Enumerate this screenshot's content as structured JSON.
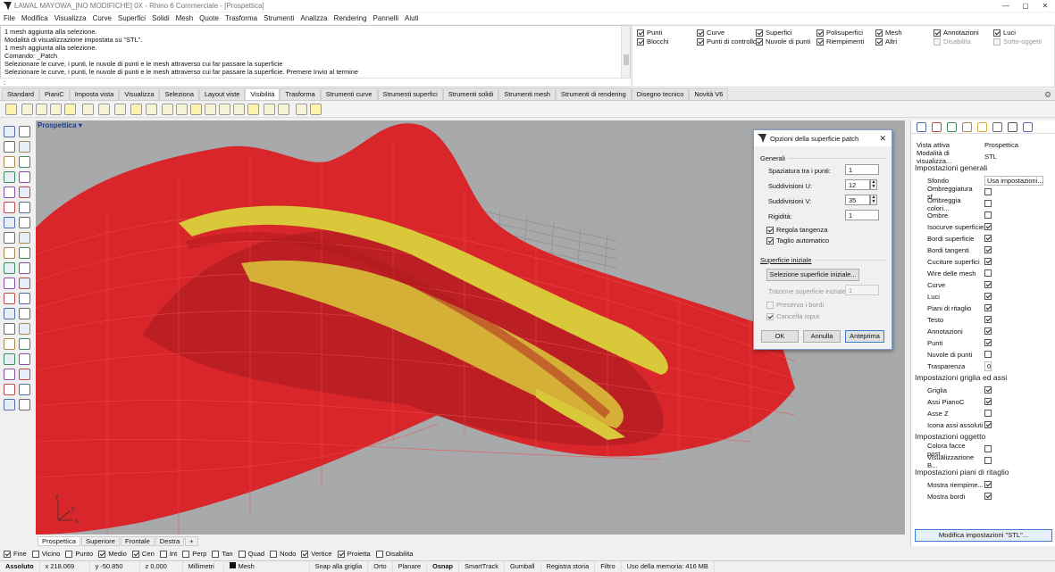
{
  "window": {
    "title": "LAWAL MAYOWA_[NO MODIFICHE] 0X - Rhino 6 Commerciale - [Prospettica]",
    "minimize": "—",
    "maximize": "▢",
    "close": "✕"
  },
  "menu": [
    "File",
    "Modifica",
    "Visualizza",
    "Curve",
    "Superfici",
    "Solidi",
    "Mesh",
    "Quote",
    "Trasforma",
    "Strumenti",
    "Analizza",
    "Rendering",
    "Pannelli",
    "Aiuti"
  ],
  "command_history": [
    "1 mesh aggiunta alla selezione.",
    "Modalità di visualizzazione impostata su \"STL\".",
    "1 mesh aggiunta alla selezione.",
    "Comando: _Patch",
    "Selezionare le curve, i punti, le nuvole di punti e le mesh attraverso cui far passare la superficie",
    "Selezionare le curve, i punti, le nuvole di punti e le mesh attraverso cui far passare la superficie. Premere Invio al termine"
  ],
  "command_prompt": ":",
  "selection_filter": [
    {
      "label": "Punti",
      "checked": true
    },
    {
      "label": "Curve",
      "checked": true
    },
    {
      "label": "Superfici",
      "checked": true
    },
    {
      "label": "Polisuperfici",
      "checked": true
    },
    {
      "label": "Mesh",
      "checked": true
    },
    {
      "label": "Annotazioni",
      "checked": true
    },
    {
      "label": "Luci",
      "checked": true
    },
    {
      "label": "Blocchi",
      "checked": true
    },
    {
      "label": "Punti di controllo",
      "checked": true
    },
    {
      "label": "Nuvole di punti",
      "checked": true
    },
    {
      "label": "Riempimenti",
      "checked": true
    },
    {
      "label": "Altri",
      "checked": true
    },
    {
      "label": "Disabilita",
      "checked": false,
      "disabled": true
    },
    {
      "label": "Sotto-oggetti",
      "checked": false,
      "disabled": true
    }
  ],
  "toolbar_tabs": [
    "Standard",
    "PianiC",
    "Imposta vista",
    "Visualizza",
    "Seleziona",
    "Layout viste",
    "Visibilità",
    "Trasforma",
    "Strumenti curve",
    "Strumenti superfici",
    "Strumenti solidi",
    "Strumenti mesh",
    "Strumenti di rendering",
    "Disegno tecnico",
    "Novità V6"
  ],
  "active_toolbar_tab": "Visibilità",
  "viewport": {
    "title": "Prospettica",
    "dropdown": "▾",
    "axis_x": "x",
    "axis_y": "y",
    "axis_z": "z"
  },
  "viewport_tabs": [
    "Prospettica",
    "Superiore",
    "Frontale",
    "Destra"
  ],
  "viewport_tab_add": "+",
  "dialog": {
    "title": "Opzioni della superficie patch",
    "close": "✕",
    "group_general": "Generali",
    "spacing_label": "Spaziatura tra i punti:",
    "spacing_value": "1",
    "u_label": "Suddivisioni U:",
    "u_value": "12",
    "v_label": "Suddivisioni V:",
    "v_value": "35",
    "stiffness_label": "Rigidità:",
    "stiffness_value": "1",
    "adjust_tangency": "Regola tangenza",
    "auto_trim": "Taglio automatico",
    "group_initial": "Superficie iniziale",
    "select_initial": "Selezione superficie iniziale...",
    "pull_label": "Trazione superficie iniziale:",
    "pull_value": "1",
    "preserve_edges": "Preserva i bordi",
    "delete_input": "Cancella input",
    "ok": "OK",
    "cancel": "Annulla",
    "preview": "Anteprima"
  },
  "properties": {
    "active_view_label": "Vista attiva",
    "active_view_value": "Prospettica",
    "display_mode_label": "Modalità di visualizza...",
    "display_mode_value": "STL",
    "sec_general": "Impostazioni generali",
    "background_label": "Sfondo",
    "background_value": "Usa impostazioni...",
    "general_items": [
      {
        "label": "Ombreggiatura sf...",
        "checked": false
      },
      {
        "label": "Ombreggia colori...",
        "checked": false
      },
      {
        "label": "Ombre",
        "checked": false
      },
      {
        "label": "Isocurve superficie",
        "checked": true
      },
      {
        "label": "Bordi superficie",
        "checked": true
      },
      {
        "label": "Bordi tangenti",
        "checked": true
      },
      {
        "label": "Cuciture superfici",
        "checked": true
      },
      {
        "label": "Wire delle mesh",
        "checked": false
      },
      {
        "label": "Curve",
        "checked": true
      },
      {
        "label": "Luci",
        "checked": true
      },
      {
        "label": "Piani di ritaglio",
        "checked": true
      },
      {
        "label": "Testo",
        "checked": true
      },
      {
        "label": "Annotazioni",
        "checked": true
      },
      {
        "label": "Punti",
        "checked": true
      },
      {
        "label": "Nuvole di punti",
        "checked": false
      }
    ],
    "transparency_label": "Trasparenza",
    "transparency_value": "0",
    "sec_grid": "Impostazioni griglia ed assi",
    "grid_items": [
      {
        "label": "Griglia",
        "checked": true
      },
      {
        "label": "Assi PianoC",
        "checked": true
      },
      {
        "label": "Asse Z",
        "checked": false
      },
      {
        "label": "Icona assi assoluti",
        "checked": true
      }
    ],
    "sec_object": "Impostazioni oggetto",
    "object_items": [
      {
        "label": "Colora facce post...",
        "checked": false
      },
      {
        "label": "Visualizzazione B...",
        "checked": false
      }
    ],
    "sec_clip": "Impostazioni piani di ritaglio",
    "clip_items": [
      {
        "label": "Mostra riempime...",
        "checked": true
      },
      {
        "label": "Mostra bordi",
        "checked": true
      }
    ],
    "modify_button": "Modifica impostazioni \"STL\"..."
  },
  "osnaps": [
    {
      "label": "Fine",
      "checked": true
    },
    {
      "label": "Vicino",
      "checked": false
    },
    {
      "label": "Punto",
      "checked": false
    },
    {
      "label": "Medio",
      "checked": true
    },
    {
      "label": "Cen",
      "checked": true
    },
    {
      "label": "Int",
      "checked": false
    },
    {
      "label": "Perp",
      "checked": false
    },
    {
      "label": "Tan",
      "checked": false
    },
    {
      "label": "Quad",
      "checked": false
    },
    {
      "label": "Nodo",
      "checked": false
    },
    {
      "label": "Vertice",
      "checked": true
    },
    {
      "label": "Proietta",
      "checked": true
    },
    {
      "label": "Disabilita",
      "checked": false
    }
  ],
  "status": {
    "plane": "Assoluto",
    "x": "x 218.069",
    "y": "y -50.850",
    "z": "z 0.000",
    "units": "Millimetri",
    "layer": "Mesh",
    "snap": "Snap alla griglia",
    "ortho": "Orto",
    "planar": "Planare",
    "osnap": "Osnap",
    "smarttrack": "SmartTrack",
    "gumball": "Gumball",
    "history": "Registra storia",
    "filter": "Filtro",
    "memory": "Uso della memoria: 416 MB"
  },
  "colors": {
    "surface_red": "#d8262a",
    "mesh_yellow": "#d9c93a",
    "viewport_bg": "#a7a9ab",
    "accent_blue": "#1b3f8f"
  }
}
